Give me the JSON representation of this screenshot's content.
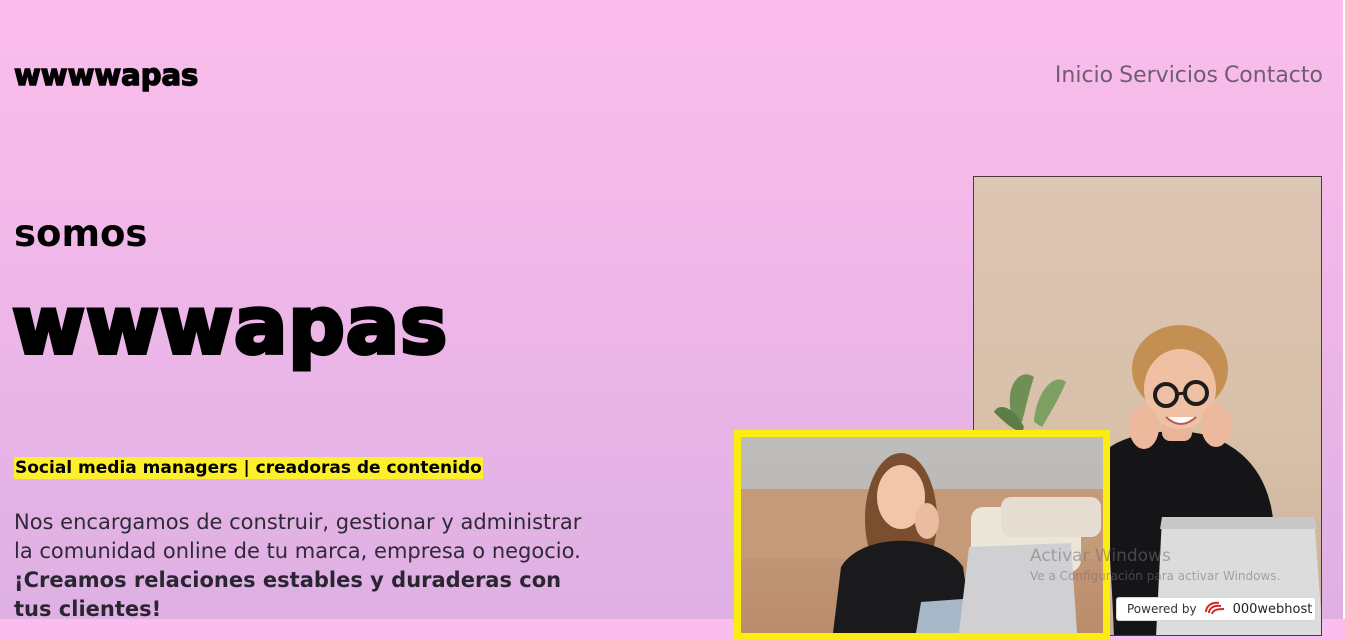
{
  "header": {
    "logo": "wwwwapas",
    "nav": [
      "Inicio",
      "Servicios",
      "Contacto"
    ]
  },
  "hero": {
    "intro": "somos",
    "brand": "wwwapas",
    "tagline": "Social media managers | creadoras de contenido",
    "description_line1": "Nos encargamos de construir, gestionar y administrar",
    "description_line2": "la comunidad online de tu marca, empresa o negocio.",
    "description_bold": "¡Creamos relaciones estables y duraderas con tus clientes!"
  },
  "overlay": {
    "windows_title": "Activar Windows",
    "windows_subtitle": "Ve a Configuración para activar Windows.",
    "powered_label": "Powered by",
    "powered_host": "000webhost"
  },
  "colors": {
    "tag_highlight": "#fdef2b",
    "photo_frame": "#fdec10",
    "background_top": "#fbbdec",
    "background_bottom": "#deb0e4"
  }
}
